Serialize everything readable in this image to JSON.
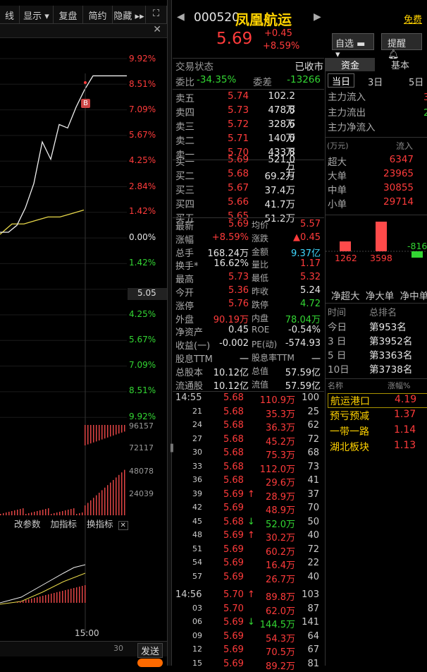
{
  "toolbar": {
    "items": [
      "线",
      "显示 ▾",
      "复盘",
      "简约",
      "隐藏 ▸▸",
      "⛶"
    ]
  },
  "chart": {
    "pct_up": [
      "9.92%",
      "8.51%",
      "7.09%",
      "5.67%",
      "4.25%",
      "2.84%",
      "1.42%"
    ],
    "zero": "0.00%",
    "pct_dn": [
      "1.42%",
      "2.84%",
      "4.25%",
      "5.67%",
      "7.09%",
      "8.51%",
      "9.92%"
    ],
    "price_marker": "5.05",
    "buy_marker": "B",
    "vol_labels": [
      "96157",
      "72117",
      "48078",
      "24039"
    ],
    "indicator_btns": [
      "改参数",
      "加指标",
      "换指标"
    ],
    "time_label": "15:00",
    "bottom_num": "30",
    "send": "发送",
    "avg_series": [
      5.24,
      5.27,
      5.27,
      5.28,
      5.29,
      5.29,
      5.3,
      5.31
    ],
    "price_series": [
      5.24,
      5.24,
      5.26,
      5.31,
      5.38,
      5.5,
      5.45,
      5.55,
      5.54,
      5.6,
      5.65,
      5.69,
      5.69,
      5.69,
      5.69,
      5.69
    ]
  },
  "header": {
    "code": "000520",
    "name": "凤凰航运",
    "price": "5.69",
    "change": "+0.45",
    "change_pct": "+8.59%",
    "watch_btn": "自选 ▬ ▾",
    "remind_btn": "提醒",
    "free_link": "免费",
    "prev_arrow": "◀",
    "next_arrow": "▶"
  },
  "status": {
    "label": "交易状态",
    "value": "已收市",
    "wb_label": "委比",
    "wb_value": "-34.35%",
    "wc_label": "委差",
    "wc_value": "-13266"
  },
  "asks": [
    {
      "label": "卖五",
      "price": "5.74",
      "vol": "102.2万"
    },
    {
      "label": "卖四",
      "price": "5.73",
      "vol": "478.8万"
    },
    {
      "label": "卖三",
      "price": "5.72",
      "vol": "328.6万"
    },
    {
      "label": "卖二",
      "price": "5.71",
      "vol": "140.0万"
    },
    {
      "label": "卖一",
      "price": "5.70",
      "vol": "433.8万"
    }
  ],
  "bids": [
    {
      "label": "买一",
      "price": "5.69",
      "vol": "521.0万"
    },
    {
      "label": "买二",
      "price": "5.68",
      "vol": "69.2万"
    },
    {
      "label": "买三",
      "price": "5.67",
      "vol": "37.4万"
    },
    {
      "label": "买四",
      "price": "5.66",
      "vol": "41.7万"
    },
    {
      "label": "买五",
      "price": "5.65",
      "vol": "51.2万"
    }
  ],
  "stats": [
    [
      "最新",
      "5.69",
      "均价",
      "5.57"
    ],
    [
      "涨幅",
      "+8.59%",
      "涨跌",
      "▲0.45"
    ],
    [
      "总手",
      "168.24万",
      "金额",
      "9.37亿"
    ],
    [
      "换手*",
      "16.62%",
      "量比",
      "1.17"
    ],
    [
      "最高",
      "5.73",
      "最低",
      "5.32"
    ],
    [
      "今开",
      "5.36",
      "昨收",
      "5.24"
    ],
    [
      "涨停",
      "5.76",
      "跌停",
      "4.72"
    ],
    [
      "外盘",
      "90.19万",
      "内盘",
      "78.04万"
    ],
    [
      "净资产",
      "0.45",
      "ROE",
      "-0.54%"
    ],
    [
      "收益(一)",
      "-0.002",
      "PE(动)",
      "-574.93"
    ],
    [
      "股息TTM",
      "一",
      "股息率TTM",
      "一"
    ],
    [
      "总股本",
      "10.12亿",
      "总值",
      "57.59亿"
    ],
    [
      "流通股",
      "10.12亿",
      "流值",
      "57.59亿"
    ]
  ],
  "ticks": [
    {
      "t": "14:55",
      "p": "5.68",
      "a": "",
      "v": "110.9万",
      "n": "100"
    },
    {
      "t": "21",
      "p": "5.68",
      "a": "",
      "v": "35.3万",
      "n": "25"
    },
    {
      "t": "24",
      "p": "5.68",
      "a": "",
      "v": "36.3万",
      "n": "62"
    },
    {
      "t": "27",
      "p": "5.68",
      "a": "",
      "v": "45.2万",
      "n": "72"
    },
    {
      "t": "30",
      "p": "5.68",
      "a": "",
      "v": "75.3万",
      "n": "68"
    },
    {
      "t": "33",
      "p": "5.68",
      "a": "",
      "v": "112.0万",
      "n": "73"
    },
    {
      "t": "36",
      "p": "5.68",
      "a": "",
      "v": "29.6万",
      "n": "41"
    },
    {
      "t": "39",
      "p": "5.69",
      "a": "↑",
      "v": "28.9万",
      "n": "37"
    },
    {
      "t": "42",
      "p": "5.69",
      "a": "",
      "v": "48.9万",
      "n": "70"
    },
    {
      "t": "45",
      "p": "5.68",
      "a": "↓",
      "v": "52.0万",
      "n": "50"
    },
    {
      "t": "48",
      "p": "5.69",
      "a": "↑",
      "v": "30.2万",
      "n": "40"
    },
    {
      "t": "51",
      "p": "5.69",
      "a": "",
      "v": "60.2万",
      "n": "72"
    },
    {
      "t": "54",
      "p": "5.69",
      "a": "",
      "v": "16.4万",
      "n": "22"
    },
    {
      "t": "57",
      "p": "5.69",
      "a": "",
      "v": "26.7万",
      "n": "40"
    },
    {
      "t": "14:56",
      "p": "5.70",
      "a": "↑",
      "v": "89.8万",
      "n": "103"
    },
    {
      "t": "03",
      "p": "5.70",
      "a": "",
      "v": "62.0万",
      "n": "87"
    },
    {
      "t": "06",
      "p": "5.69",
      "a": "↓",
      "v": "144.5万",
      "n": "141"
    },
    {
      "t": "09",
      "p": "5.69",
      "a": "",
      "v": "54.3万",
      "n": "64"
    },
    {
      "t": "12",
      "p": "5.69",
      "a": "",
      "v": "70.5万",
      "n": "67"
    },
    {
      "t": "15",
      "p": "5.69",
      "a": "",
      "v": "89.2万",
      "n": "81"
    }
  ],
  "right": {
    "tabs": [
      "资金",
      "基本"
    ],
    "subtabs": [
      "当日",
      "3日",
      "5日"
    ],
    "flow": [
      "主力流入",
      "主力流出",
      "主力净流入"
    ],
    "flow_vals": [
      "3",
      "2",
      ""
    ],
    "unit": "(万元)",
    "in_label": "流入",
    "sizes": [
      {
        "l": "超大",
        "v": "6347"
      },
      {
        "l": "大单",
        "v": "23965"
      },
      {
        "l": "中单",
        "v": "30855"
      },
      {
        "l": "小单",
        "v": "29714"
      }
    ],
    "bar_vals": [
      "1262",
      "3598",
      "-816"
    ],
    "net_labels": [
      "净超大",
      "净大单",
      "净中单"
    ],
    "rank_head": [
      "时间",
      "总排名"
    ],
    "ranks": [
      {
        "t": "今日",
        "r": "第953名"
      },
      {
        "t": "3 日",
        "r": "第3952名"
      },
      {
        "t": "5 日",
        "r": "第3363名"
      },
      {
        "t": "10日",
        "r": "第3738名"
      }
    ],
    "sector_head": [
      "名称",
      "涨幅%"
    ],
    "sectors": [
      {
        "n": "航运港口",
        "v": "4.19"
      },
      {
        "n": "预亏预减",
        "v": "1.37"
      },
      {
        "n": "一带一路",
        "v": "1.14"
      },
      {
        "n": "湖北板块",
        "v": "1.13"
      }
    ]
  },
  "colors": {
    "up": "#ff3b3b",
    "down": "#33d633",
    "accent": "#ffd200",
    "cyan": "#3fd8ff"
  }
}
